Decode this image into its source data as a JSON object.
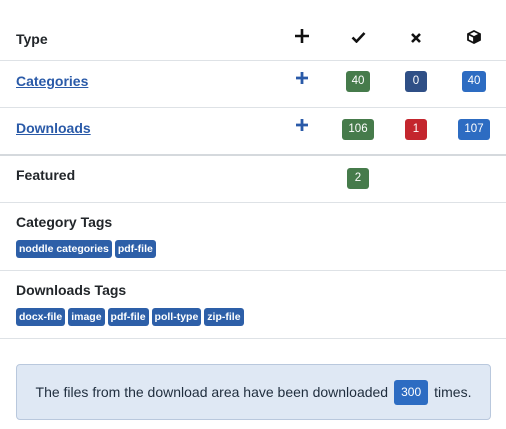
{
  "header": {
    "type_label": "Type",
    "col_add_icon": "plus-icon",
    "col_published_icon": "check-icon",
    "col_unpublished_icon": "x-icon",
    "col_archived_icon": "box-icon"
  },
  "rows": [
    {
      "label": "Categories",
      "published": "40",
      "unpublished": "0",
      "total": "40"
    },
    {
      "label": "Downloads",
      "published": "106",
      "unpublished": "1",
      "total": "107"
    },
    {
      "label": "Featured",
      "published": "2"
    }
  ],
  "category_tags": {
    "label": "Category Tags",
    "tags": [
      "noddle categories",
      "pdf-file"
    ]
  },
  "downloads_tags": {
    "label": "Downloads Tags",
    "tags": [
      "docx-file",
      "image",
      "pdf-file",
      "poll-type",
      "zip-file"
    ]
  },
  "alert": {
    "before": "The files from the download area have been downloaded",
    "count": "300",
    "after": "times."
  },
  "colors": {
    "link": "#2a5aa8",
    "badge_green": "#467b4b",
    "badge_navy": "#2f4f86",
    "badge_blue": "#2d6cc2",
    "badge_red": "#c4262e",
    "alert_bg": "#dfe8f4"
  }
}
